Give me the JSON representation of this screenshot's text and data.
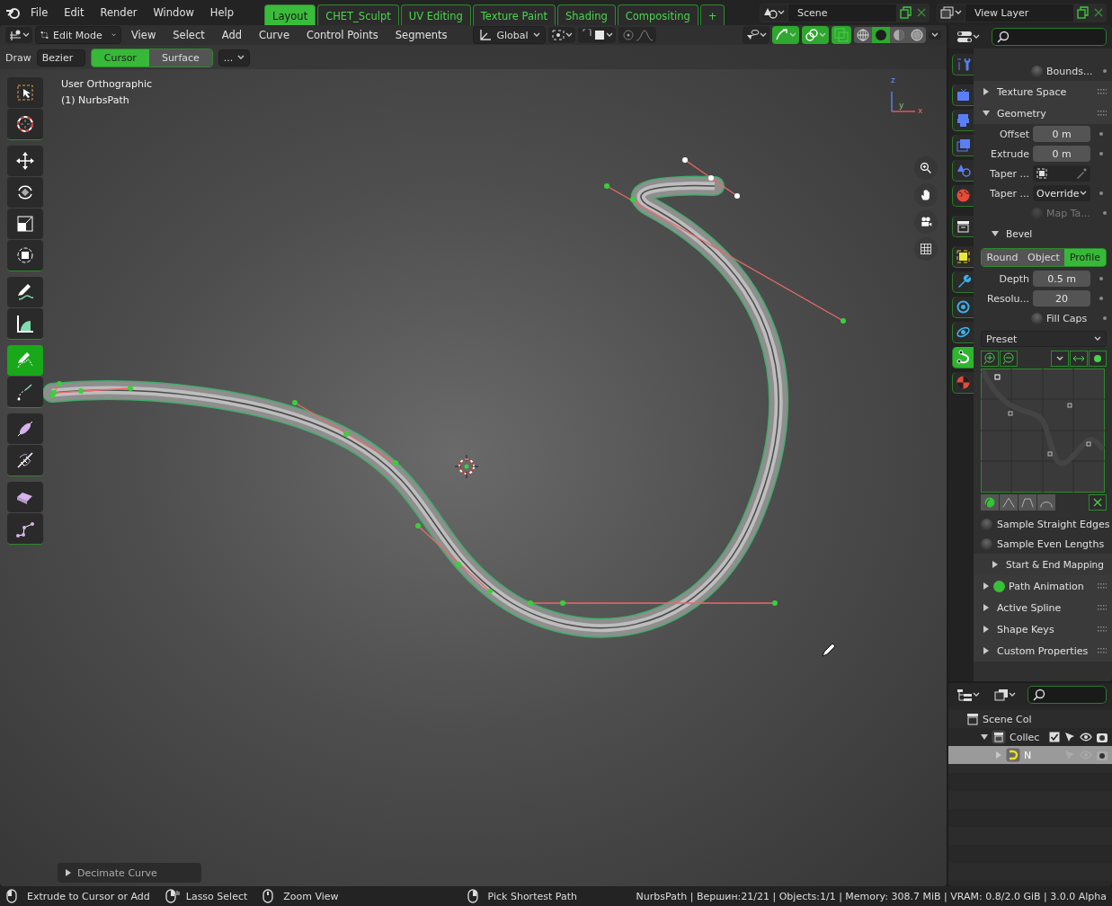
{
  "topbar": {
    "menus": [
      "File",
      "Edit",
      "Render",
      "Window",
      "Help"
    ],
    "workspaces": [
      {
        "label": "Layout",
        "selected": true
      },
      {
        "label": "CHET_Sculpt",
        "selected": false
      },
      {
        "label": "UV Editing",
        "selected": false
      },
      {
        "label": "Texture Paint",
        "selected": false
      },
      {
        "label": "Shading",
        "selected": false
      },
      {
        "label": "Compositing",
        "selected": false
      }
    ],
    "add_tab": "+",
    "scene": "Scene",
    "view_layer": "View Layer"
  },
  "viewport_header": {
    "mode": "Edit Mode",
    "menus": [
      "View",
      "Select",
      "Add",
      "Curve",
      "Control Points",
      "Segments"
    ],
    "orientation": "Global",
    "snap_on": false,
    "proportional_on": false,
    "toggles": [
      {
        "on": false
      },
      {
        "on": true
      },
      {
        "on": true
      },
      {
        "on": true
      }
    ],
    "shading": [
      {
        "selected": false
      },
      {
        "selected": true
      },
      {
        "selected": false
      },
      {
        "selected": false
      }
    ]
  },
  "tool_settings": {
    "label": "Draw",
    "type": "Bezier",
    "depth": [
      {
        "label": "Cursor",
        "selected": true
      },
      {
        "label": "Surface",
        "selected": false
      }
    ],
    "more": "..."
  },
  "overlay": {
    "view_name": "User Orthographic",
    "object": "(1) NurbsPath",
    "axes": [
      "z",
      "y",
      "x"
    ]
  },
  "tool_groups": [
    [
      {
        "selected": false
      },
      {
        "selected": false
      }
    ],
    [
      {
        "selected": false
      },
      {
        "selected": false
      },
      {
        "selected": false
      },
      {
        "selected": false
      }
    ],
    [
      {
        "selected": false
      },
      {
        "selected": false
      }
    ],
    [
      {
        "selected": true
      },
      {
        "selected": false
      }
    ],
    [
      {
        "selected": false
      },
      {
        "selected": false
      }
    ],
    [
      {
        "selected": false
      },
      {
        "selected": false
      }
    ]
  ],
  "last_operator": {
    "label": "Decimate Curve",
    "expanded": false
  },
  "properties": {
    "tabs": [
      {
        "selected": false
      },
      {
        "selected": false
      },
      {
        "selected": false
      },
      {
        "selected": false
      },
      {
        "selected": false
      },
      {
        "selected": false
      },
      {
        "selected": false
      },
      {
        "selected": false
      },
      {
        "selected": false
      },
      {
        "selected": false
      },
      {
        "selected": false
      },
      {
        "selected": true
      },
      {
        "selected": false
      }
    ],
    "rows": [
      {
        "kind": "checkbox",
        "label": "Bounds...",
        "checked": false,
        "disabled": false
      },
      {
        "kind": "panel",
        "label": "Texture Space",
        "expanded": false
      },
      {
        "kind": "panel",
        "label": "Geometry",
        "expanded": true
      },
      {
        "kind": "field",
        "label": "Offset",
        "value": "0 m"
      },
      {
        "kind": "field",
        "label": "Extrude",
        "value": "0 m"
      },
      {
        "kind": "object",
        "label": "Taper ..."
      },
      {
        "kind": "dropdown",
        "label": "Taper ...",
        "value": "Override"
      },
      {
        "kind": "checkbox",
        "label": "Map Ta...",
        "checked": false,
        "disabled": true
      },
      {
        "kind": "subpanel",
        "label": "Bevel",
        "expanded": true
      },
      {
        "kind": "segmented",
        "options": [
          {
            "label": "Round",
            "selected": false
          },
          {
            "label": "Object",
            "selected": false
          },
          {
            "label": "Profile",
            "selected": true
          }
        ]
      },
      {
        "kind": "field",
        "label": "Depth",
        "value": "0.5 m"
      },
      {
        "kind": "field",
        "label": "Resolu...",
        "value": "20"
      },
      {
        "kind": "checkbox",
        "label": "Fill Caps",
        "checked": false,
        "disabled": false
      },
      {
        "kind": "preset",
        "value": "Preset"
      },
      {
        "kind": "profile"
      },
      {
        "kind": "option",
        "label": "Sample Straight Edges",
        "checked": false
      },
      {
        "kind": "option",
        "label": "Sample Even Lengths",
        "checked": false
      },
      {
        "kind": "subpanel",
        "label": "Start & End Mapping",
        "expanded": false
      },
      {
        "kind": "panel",
        "label": "Path Animation",
        "expanded": false,
        "checked": true
      },
      {
        "kind": "panel",
        "label": "Active Spline",
        "expanded": false
      },
      {
        "kind": "panel",
        "label": "Shape Keys",
        "expanded": false
      },
      {
        "kind": "panel",
        "label": "Custom Properties",
        "expanded": false
      }
    ]
  },
  "outliner": {
    "items": [
      {
        "label": "Scene Col",
        "selected": false,
        "children": [
          {
            "label": "Collec",
            "selected": false,
            "expanded": true,
            "checked": true,
            "children": [
              {
                "label": "N",
                "selected": true,
                "expanded": false
              }
            ]
          }
        ]
      }
    ]
  },
  "status_bar": {
    "hints": [
      "Extrude to Cursor or Add",
      "Lasso Select",
      "Zoom View",
      "Pick Shortest Path"
    ],
    "stats": "NurbsPath | Вершин:21/21 | Objects:1/1 | Memory: 308.7 MiB | VRAM: 0.8/2.0 GiB | 3.0.0 Alpha"
  }
}
